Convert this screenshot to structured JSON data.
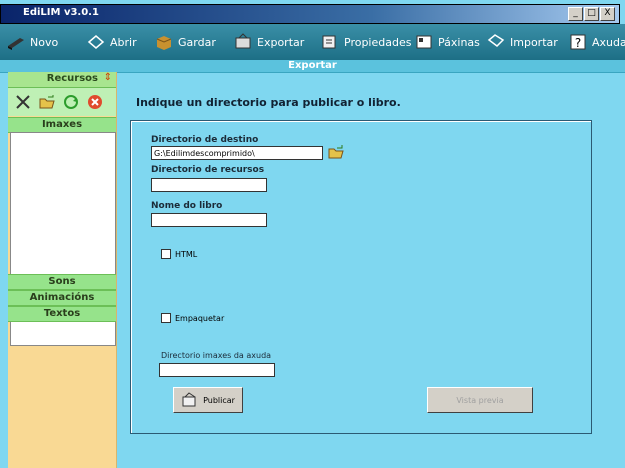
{
  "window": {
    "title": "EdiLIM v3.0.1",
    "buttons": [
      "_",
      "□",
      "X"
    ]
  },
  "toolbar": {
    "items": [
      {
        "label": "Novo",
        "icon": "book-icon"
      },
      {
        "label": "Abrir",
        "icon": "open-icon"
      },
      {
        "label": "Gardar",
        "icon": "save-box-icon"
      },
      {
        "label": "Exportar",
        "icon": "export-icon"
      },
      {
        "label": "Propiedades",
        "icon": "properties-icon"
      },
      {
        "label": "Páxinas",
        "icon": "pages-icon"
      },
      {
        "label": "Importar",
        "icon": "import-icon"
      },
      {
        "label": "Axuda",
        "icon": "help-icon"
      }
    ]
  },
  "section": {
    "title": "Exportar"
  },
  "sidebar": {
    "header": "Recursos",
    "tabs": [
      "Imaxes",
      "Sons",
      "Animacións",
      "Textos"
    ]
  },
  "main": {
    "instruction": "Indique un directorio para publicar o libro.",
    "dest_label": "Directorio de destino",
    "dest_value": "G:\\Edilimdescomprimido\\",
    "resources_label": "Directorio de recursos",
    "resources_value": "",
    "bookname_label": "Nome do libro",
    "bookname_value": "",
    "html_label": "HTML",
    "package_label": "Empaquetar",
    "help_images_label": "Directorio imaxes da axuda",
    "help_images_value": "",
    "publish_label": "Publicar",
    "preview_label": "Vista previa"
  },
  "colors": {
    "background": "#7fd7f0",
    "toolbar": "#1d6f86",
    "sidebar": "#f9d994",
    "sidebar_tab": "#96e38b"
  }
}
